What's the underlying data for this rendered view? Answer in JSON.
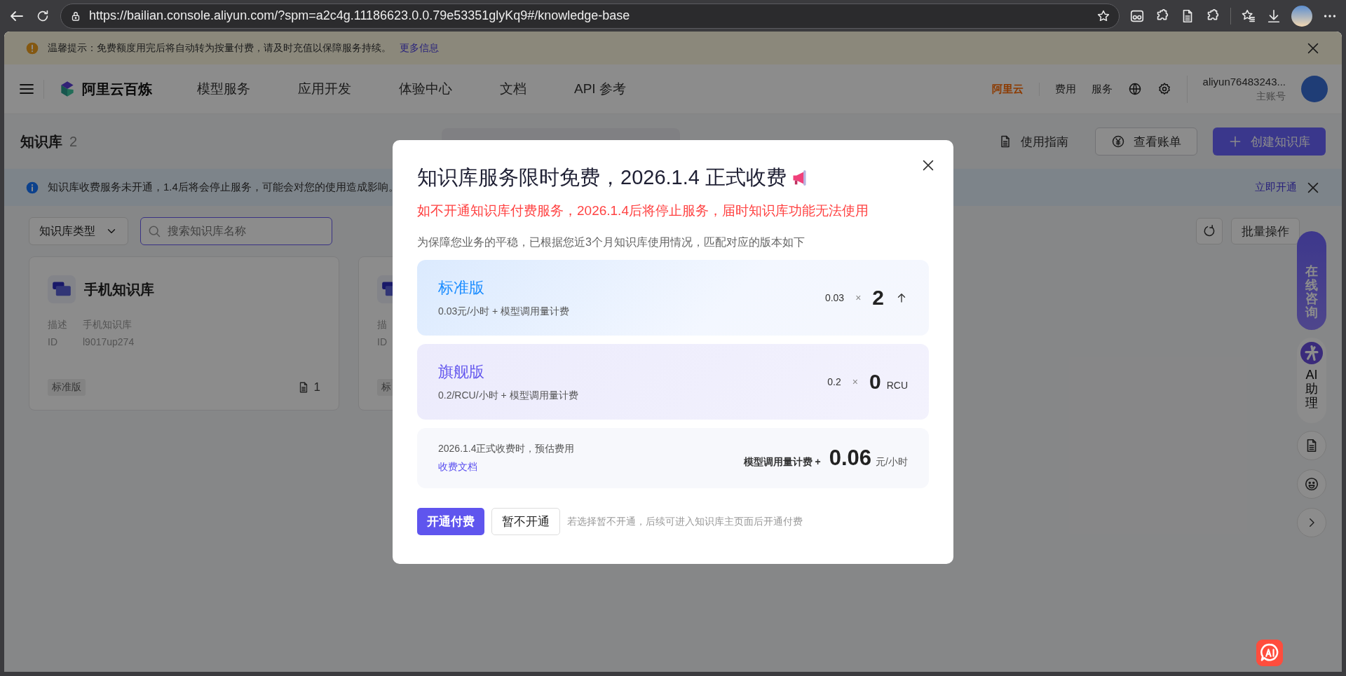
{
  "browser": {
    "url": "https://bailian.console.aliyun.com/?spm=a2c4g.11186623.0.0.79e53351glyKq9#/knowledge-base"
  },
  "notice": {
    "text": "温馨提示：免费额度用完后将自动转为按量付费，请及时充值以保障服务持续。",
    "link": "更多信息"
  },
  "nav": {
    "brand": "阿里云百炼",
    "items": [
      "模型服务",
      "应用开发",
      "体验中心",
      "文档",
      "API 参考"
    ],
    "aliyun_logo": "阿里云",
    "links": [
      "费用",
      "服务"
    ],
    "account": {
      "name": "aliyun76483243...",
      "role": "主账号"
    }
  },
  "header": {
    "title": "知识库",
    "count": "2",
    "actions": [
      {
        "kind": "link",
        "label": "使用指南"
      },
      {
        "kind": "outline",
        "label": "查看账单"
      },
      {
        "kind": "primary",
        "label": "创建知识库"
      }
    ]
  },
  "alert": {
    "text": "知识库收费服务未开通，1.4后将会停止服务，可能会对您的使用造成影响。",
    "action": "立即开通"
  },
  "filters": {
    "type_select": "知识库类型",
    "search_placeholder": "搜索知识库名称",
    "batch": "批量操作"
  },
  "cards": [
    {
      "name": "手机知识库",
      "fields": [
        {
          "label": "描述",
          "value": "手机知识库"
        },
        {
          "label": "ID",
          "value": "l9017up274"
        }
      ],
      "edition": "标准版",
      "doc_count": "1"
    },
    {
      "fields": [
        {
          "label": "描"
        },
        {
          "label": "ID"
        }
      ],
      "edition": "标"
    }
  ],
  "side_tools": {
    "consult": "在线咨询",
    "assistant": "AI助理"
  },
  "modal": {
    "title": "知识库服务限时免费，2026.1.4 正式收费",
    "warning": "如不开通知识库付费服务，2026.1.4后将停止服务，届时知识库功能无法使用",
    "intro": "为保障您业务的平稳，已根据您近3个月知识库使用情况，匹配对应的版本如下",
    "plans": [
      {
        "kind": "standard",
        "name": "标准版",
        "price": "0.03元/小时 + 模型调用量计费",
        "rate": "0.03",
        "times": "×",
        "quantity": "2"
      },
      {
        "kind": "flagship",
        "name": "旗舰版",
        "price": "0.2/RCU/小时 + 模型调用量计费",
        "rate": "0.2",
        "times": "×",
        "quantity": "0",
        "unit": "RCU"
      }
    ],
    "estimate": {
      "label": "2026.1.4正式收费时，预估费用",
      "link": "收费文档",
      "prefix": "模型调用量计费 +",
      "amount": "0.06",
      "unit": "元/小时"
    },
    "buttons": [
      {
        "kind": "primary",
        "label": "开通付费"
      },
      {
        "kind": "default",
        "label": "暂不开通"
      }
    ],
    "note": "若选择暂不开通，后续可进入知识库主页面后开通付费"
  }
}
